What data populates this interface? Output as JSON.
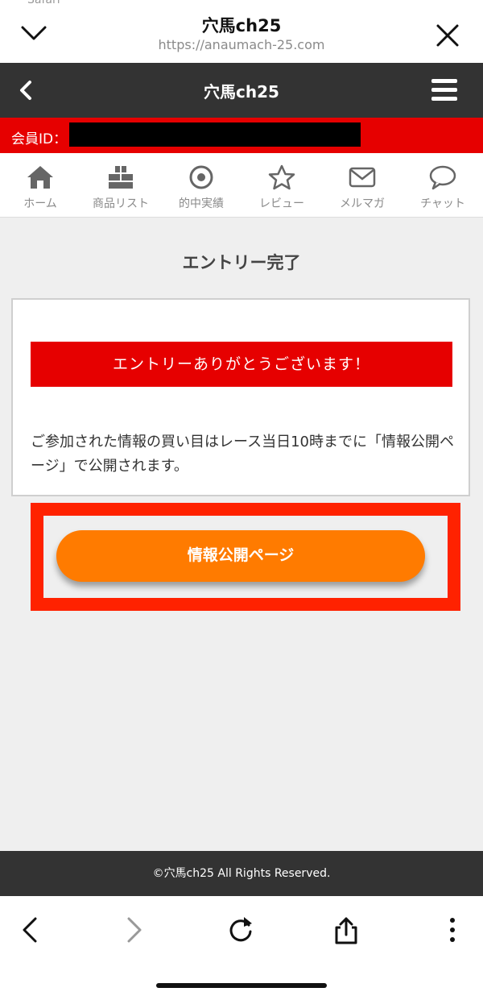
{
  "browser": {
    "title": "穴馬ch25",
    "url": "https://anaumach-25.com",
    "status_fragment": "Safari"
  },
  "site_header": {
    "title": "穴馬ch25"
  },
  "member": {
    "label": "会員ID："
  },
  "nav": {
    "items": [
      {
        "label": "ホーム",
        "icon": "home-icon"
      },
      {
        "label": "商品リスト",
        "icon": "boxes-icon"
      },
      {
        "label": "的中実績",
        "icon": "target-icon"
      },
      {
        "label": "レビュー",
        "icon": "star-icon"
      },
      {
        "label": "メルマガ",
        "icon": "mail-icon"
      },
      {
        "label": "チャット",
        "icon": "chat-icon"
      }
    ]
  },
  "content": {
    "heading": "エントリー完了",
    "banner": "エントリーありがとうございます！",
    "message": "ご参加された情報の買い目はレース当日10時までに「情報公開ページ」で公開されます。",
    "cta": "情報公開ページ"
  },
  "footer": {
    "copyright": "©穴馬ch25 All Rights Reserved."
  },
  "colors": {
    "accent_red": "#e60000",
    "cta_orange": "#ff7b00",
    "header_dark": "#333333"
  }
}
